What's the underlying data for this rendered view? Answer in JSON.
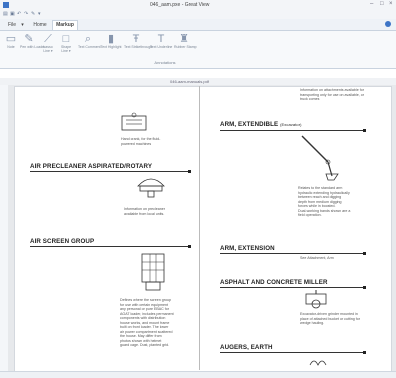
{
  "window": {
    "title": "046_aam.pxe - Great View"
  },
  "tabs": [
    "File",
    "Home",
    "Markup"
  ],
  "ribbon": {
    "tools": [
      "Note",
      "Pen with Loader",
      "Lasso",
      "Shape",
      "Text Comment",
      "Text Highlight",
      "Text Strikethrough",
      "Text Underline",
      "Rubber Stamp"
    ],
    "dropdowns": [
      "Line",
      "Line"
    ],
    "group_label": "Annotations"
  },
  "document": {
    "tab_name": "046-aam-manuals.pdf"
  },
  "content": {
    "top_left_caption": "Hand crank, for the fluid-powered machines",
    "air_precleaner": {
      "heading": "AIR PRECLEANER ASPIRATED/ROTARY",
      "caption": "Information on precleaner available from local units."
    },
    "air_screen": {
      "heading": "AIR SCREEN GROUP",
      "caption_lines": [
        "Defines where the screen group",
        "for use with certain equipment",
        "any personal or pure EBAC for",
        "AGAT loader, includes permanent",
        "components with distribution",
        "house works, and mount frame",
        "built on front loader. The lower",
        "air power compartment scattered",
        "the house. May differ from",
        "photos shown with helmet",
        "guard cage. Dust, planted grid."
      ]
    },
    "top_right_caption": "Information on attachments available for transporting only for use on available, or truck comes",
    "arm_extendible": {
      "heading": "ARM, EXTENDIBLE",
      "subheading": "(Excavator)",
      "caption_lines": [
        "Relates to the standard arm",
        "hydraulic extending hydraulically",
        "between reach and digging",
        "depth from medium digging",
        "forces while in boosted.",
        "Dual-working bands shown are a",
        "field operation."
      ]
    },
    "arm_extension": {
      "heading": "ARM, EXTENSION",
      "caption": "See Attachment, Arm"
    },
    "asphalt_miller": {
      "heading": "ASPHALT AND CONCRETE MILLER",
      "caption": "Excavator-driven grinder mounted in place of attached bucket or cutting for wedge hauling."
    },
    "augers_earth": {
      "heading": "AUGERS, EARTH"
    }
  }
}
